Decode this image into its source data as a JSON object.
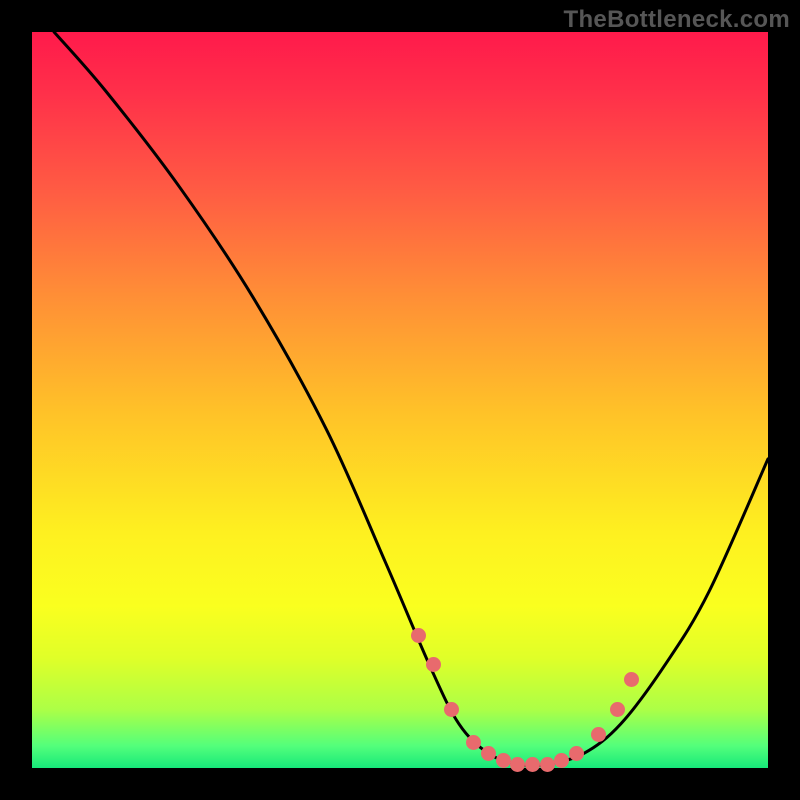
{
  "watermark": "TheBottleneck.com",
  "chart_data": {
    "type": "line",
    "title": "",
    "xlabel": "",
    "ylabel": "",
    "xlim": [
      0,
      100
    ],
    "ylim": [
      0,
      100
    ],
    "grid": false,
    "legend": false,
    "series": [
      {
        "name": "curve",
        "x": [
          3,
          10,
          20,
          30,
          40,
          48,
          54,
          58,
          62,
          66,
          70,
          75,
          80,
          86,
          92,
          100
        ],
        "y": [
          100,
          92,
          79,
          64,
          46,
          28,
          14,
          6,
          2,
          0.5,
          0.5,
          2,
          6,
          14,
          24,
          42
        ]
      }
    ],
    "markers": {
      "name": "highlighted-points",
      "color": "#e86a6d",
      "x": [
        52.5,
        54.5,
        57,
        60,
        62,
        64,
        66,
        68,
        70,
        72,
        74,
        77,
        79.5,
        81.5
      ],
      "y": [
        18,
        14,
        8,
        3.5,
        2,
        1,
        0.5,
        0.5,
        0.5,
        1,
        2,
        4.5,
        8,
        12
      ]
    }
  }
}
